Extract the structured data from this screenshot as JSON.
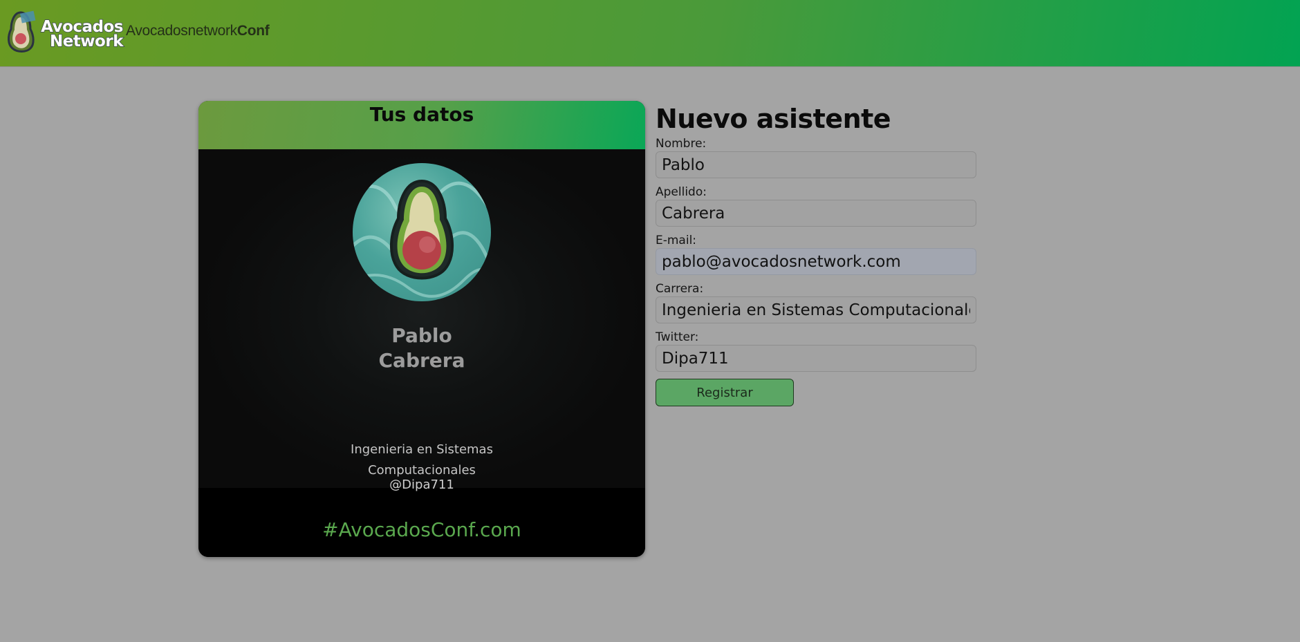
{
  "header": {
    "logo_line1": "Avocados",
    "logo_line2": "Network",
    "brand_light": "Avocadosnetwork",
    "brand_bold": "Conf"
  },
  "badge": {
    "title": "Tus datos",
    "first_name": "Pablo",
    "last_name": "Cabrera",
    "career": "Ingenieria en Sistemas Computacionales",
    "twitter": "@Dipa711",
    "hashtag": "#AvocadosConf.com"
  },
  "form": {
    "title": "Nuevo asistente",
    "fields": [
      {
        "label": "Nombre:",
        "value": "Pablo"
      },
      {
        "label": "Apellido:",
        "value": "Cabrera"
      },
      {
        "label": "E-mail:",
        "value": "pablo@avocadosnetwork.com"
      },
      {
        "label": "Carrera:",
        "value": "Ingenieria en Sistemas Computacionales"
      },
      {
        "label": "Twitter:",
        "value": "Dipa711"
      }
    ],
    "submit_label": "Registrar"
  },
  "colors": {
    "header_gradient_start": "#6a9a22",
    "header_gradient_end": "#02a352",
    "page_background": "#a4a4a4",
    "hashtag": "#5aa84e",
    "button": "#5ba664"
  }
}
